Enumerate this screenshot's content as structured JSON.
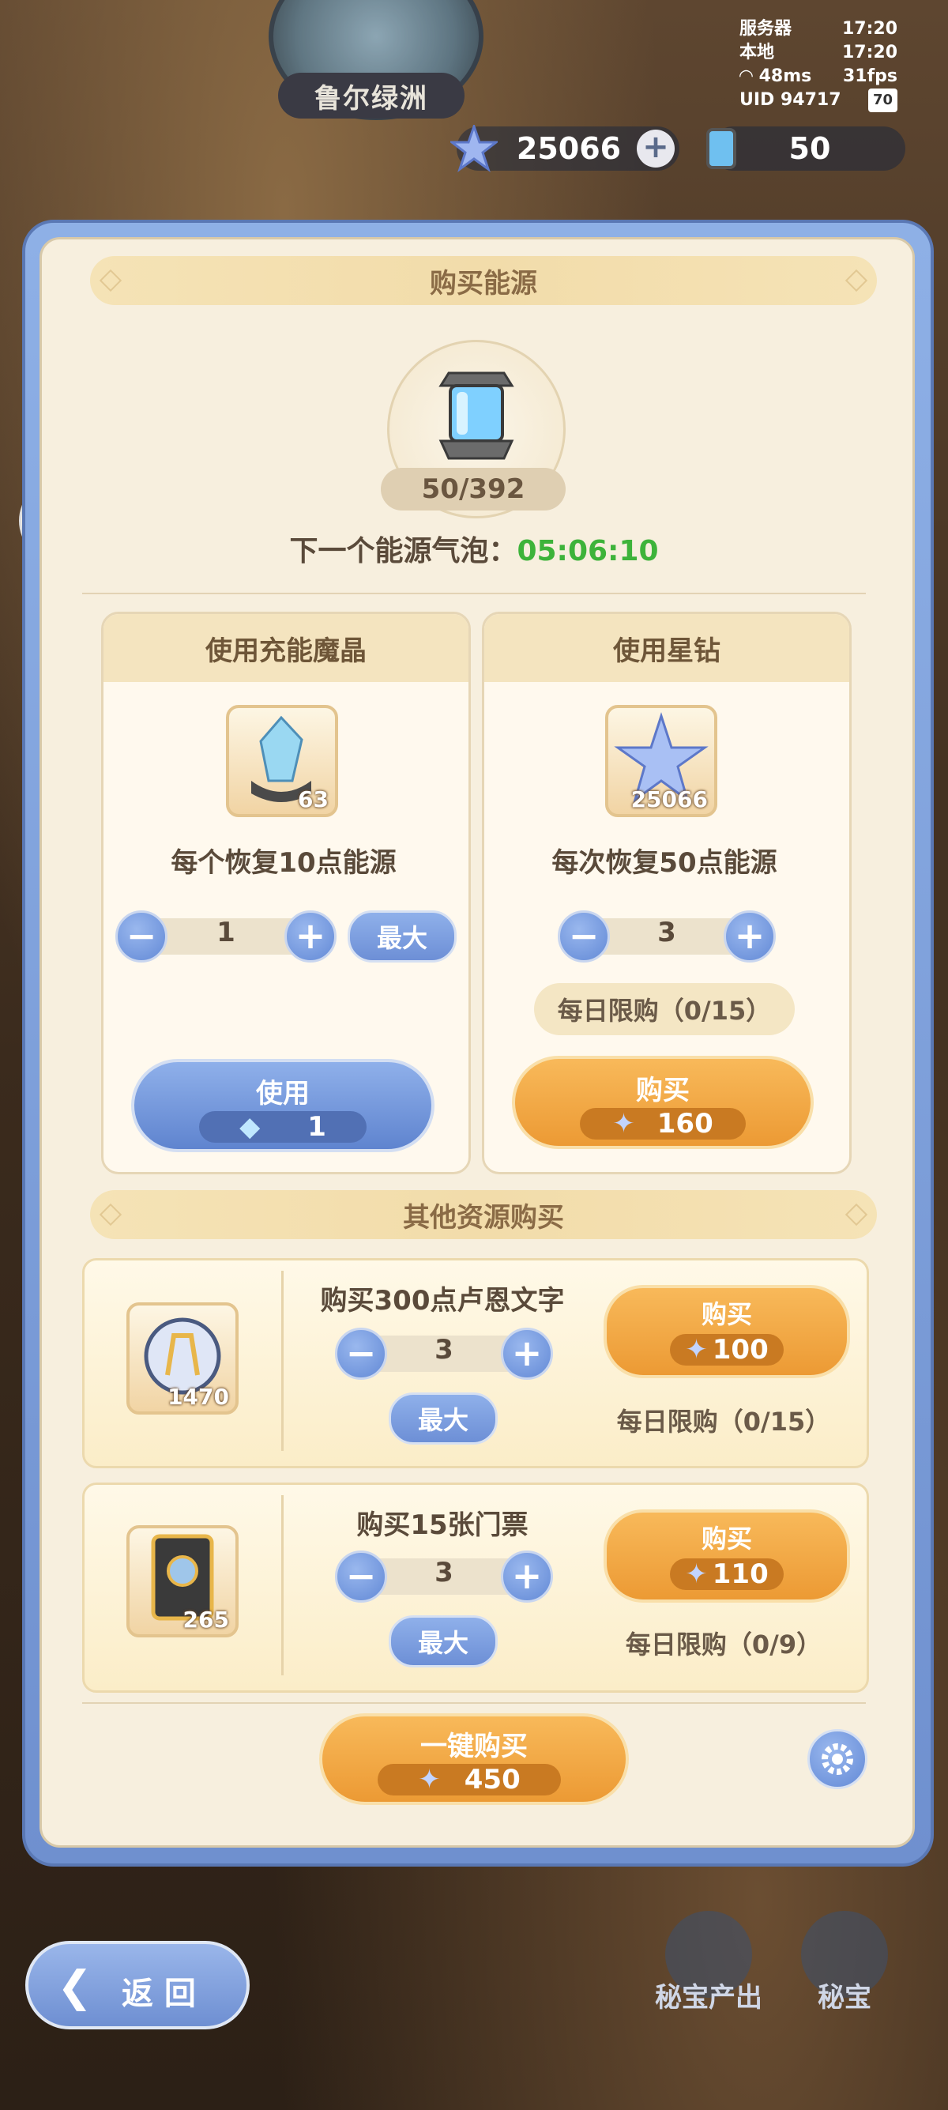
{
  "header": {
    "location": "鲁尔绿洲",
    "status": {
      "server_label": "服务器",
      "server_time": "17:20",
      "local_label": "本地",
      "local_time": "17:20",
      "ping": "48ms",
      "fps": "31fps",
      "uid": "UID 94717",
      "battery": "70"
    },
    "star_diamond": "25066",
    "energy": "50"
  },
  "buy_energy": {
    "title": "购买能源",
    "count": "50/392",
    "next_label": "下一个能源气泡：",
    "next_time": "05:06:10",
    "crystal_card": {
      "title": "使用充能魔晶",
      "item_count": "63",
      "desc": "每个恢复10点能源",
      "quantity": "1",
      "max_label": "最大",
      "use_label": "使用",
      "use_cost": "1"
    },
    "diamond_card": {
      "title": "使用星钻",
      "item_count": "25066",
      "desc": "每次恢复50点能源",
      "quantity": "3",
      "limit": "每日限购（0/15）",
      "buy_label": "购买",
      "buy_cost": "160"
    }
  },
  "other": {
    "title": "其他资源购买",
    "items": [
      {
        "title": "购买300点卢恩文字",
        "item_count": "1470",
        "quantity": "3",
        "max_label": "最大",
        "buy_label": "购买",
        "cost": "100",
        "limit": "每日限购（0/15）"
      },
      {
        "title": "购买15张门票",
        "item_count": "265",
        "quantity": "3",
        "max_label": "最大",
        "buy_label": "购买",
        "cost": "110",
        "limit": "每日限购（0/9）"
      }
    ]
  },
  "footer": {
    "one_click_label": "一键购买",
    "one_click_cost": "450",
    "back_label": "返 回",
    "treasure_output": "秘宝产出",
    "treasure": "秘宝"
  },
  "colors": {
    "accent_blue": "#6f90cf",
    "accent_orange": "#ec9a34",
    "timer_green": "#3db33a"
  }
}
